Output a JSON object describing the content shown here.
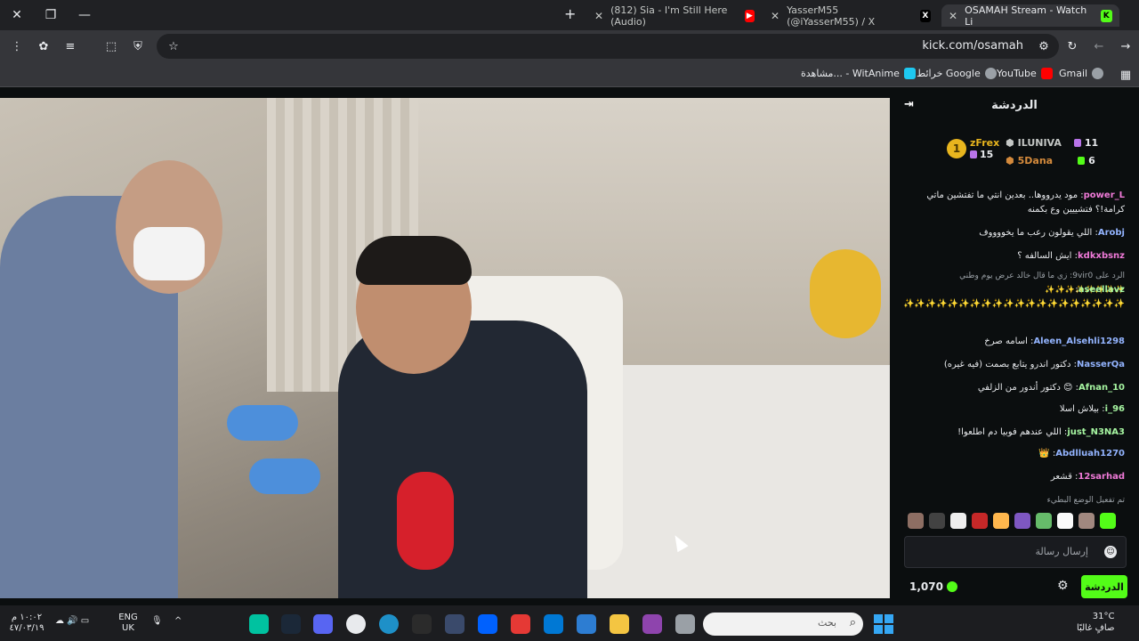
{
  "browser": {
    "tabs": [
      {
        "title": "(812) Sia - I'm Still Here (Audio)",
        "favicon": "youtube"
      },
      {
        "title": "YasserM55 (@iYasserM55) / X",
        "favicon": "x"
      },
      {
        "title": "OSAMAH Stream - Watch Li",
        "favicon": "kick",
        "active": true
      }
    ],
    "url": "kick.com/osamah",
    "bookmarks": [
      {
        "label": "Gmail",
        "icon": "chrome-icon"
      },
      {
        "label": "YouTube",
        "icon": "youtube-icon"
      },
      {
        "label": "خرائط Google",
        "icon": "maps-icon"
      },
      {
        "label": "مشاهدة... - WitAnime",
        "icon": "witanime-icon"
      }
    ]
  },
  "chat": {
    "title": "الدردشة",
    "leaderboard": [
      {
        "rank": "1",
        "name": "zFrex",
        "count": "15"
      },
      {
        "name": "ILUNIVA",
        "count": "11"
      },
      {
        "name": "5Dana",
        "count": "6"
      }
    ],
    "messages": [
      {
        "user": "power_L",
        "user_color": "#f07ad8",
        "text": "مود يدرووها.. بعدين انتي ما تفتشين ماتي كرامة!؟ فتشييين وع بكمنه"
      },
      {
        "user": "Arobj",
        "user_color": "#93b4ff",
        "text": "اللي يقولون رعب ما يخووووف"
      },
      {
        "user": "kdkxbsnz",
        "user_color": "#f07ad8",
        "text": "ايش السالفه ؟"
      },
      {
        "reply": "الرد على 9vir0: زي ما قال خالد عرض يوم وطني ✨✨✨✨✨✨✨✨"
      },
      {
        "user": "aseellavz",
        "user_color": "#a6f5a1",
        "text": "✨✨✨✨✨✨✨✨✨✨✨✨✨✨✨✨✨✨✨✨✨✨✨✨✨✨✨✨✨✨"
      },
      {
        "user": "Aleen_Alsehli1298",
        "user_color": "#93b4ff",
        "text": "اسامه صرخ"
      },
      {
        "user": "NasserQa",
        "user_color": "#93b4ff",
        "text": "دكتور اندرو يتابع بصمت (فيه غيره)"
      },
      {
        "user": "Afnan_10",
        "user_color": "#a6f5a1",
        "text": "😊 دكتور أندور من الزلفي"
      },
      {
        "user": "i_96",
        "user_color": "#a6f5a1",
        "text": "بيلاش اسلا"
      },
      {
        "user": "just_N3NA3",
        "user_color": "#a6f5a1",
        "text": "اللي عندهم فوبيا دم اطلعوا!"
      },
      {
        "user": "Abdlluah1270",
        "user_color": "#93b4ff",
        "text": "👑"
      },
      {
        "user": "12sarhad",
        "user_color": "#f07ad8",
        "text": "قشعر"
      }
    ],
    "slow_mode_note": "تم تفعيل الوضع البطيء",
    "input_placeholder": "إرسال رسالة",
    "points": "1,070",
    "send_label": "الدردشة"
  },
  "taskbar": {
    "time": "١٠:٠٢ م",
    "date": "٤٧/٠٣/١٩",
    "lang": "ENG",
    "region": "UK",
    "search_placeholder": "بحث",
    "temperature": "31°C",
    "weather": "صافٍ غالبًا"
  }
}
